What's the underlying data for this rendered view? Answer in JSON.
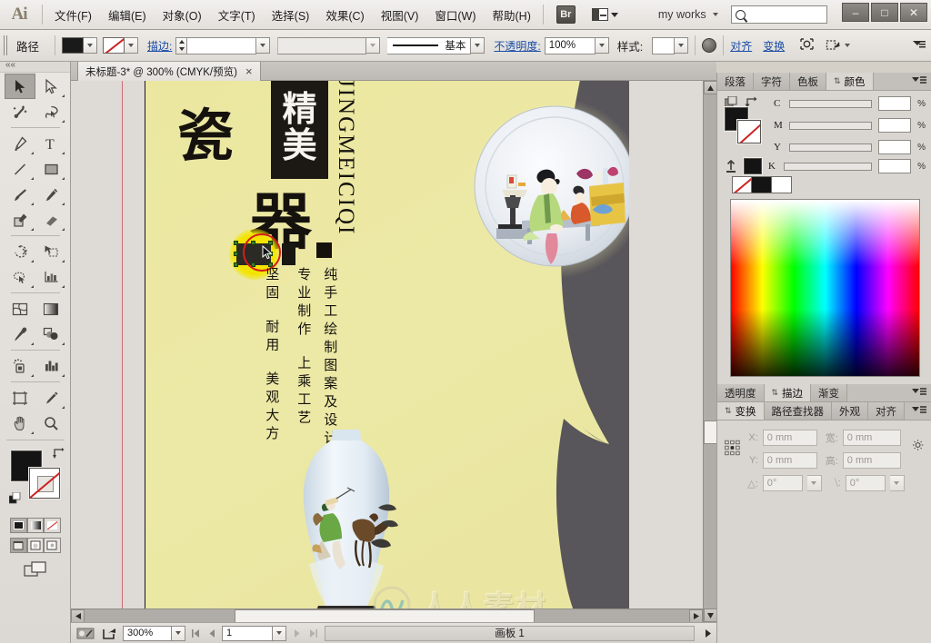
{
  "app": {
    "name": "Ai",
    "logo_text": "Ai"
  },
  "menubar": {
    "items": [
      {
        "label": "文件(F)"
      },
      {
        "label": "编辑(E)"
      },
      {
        "label": "对象(O)"
      },
      {
        "label": "文字(T)"
      },
      {
        "label": "选择(S)"
      },
      {
        "label": "效果(C)"
      },
      {
        "label": "视图(V)"
      },
      {
        "label": "窗口(W)"
      },
      {
        "label": "帮助(H)"
      }
    ],
    "bridge_label": "Br",
    "arrange_icon": "arrange-documents-icon",
    "workspace": "my works",
    "search_placeholder": "",
    "window_controls": {
      "minimize": "–",
      "maximize": "□",
      "close": "✕"
    }
  },
  "controlbar": {
    "object_label": "路径",
    "fill_swatch": "#1a1a1a",
    "stroke_swatch": "none",
    "stroke_label": "描边:",
    "stroke_weight": "",
    "stroke_profile": "",
    "brush_label": "基本",
    "opacity_label": "不透明度:",
    "opacity_value": "100%",
    "style_label": "样式:",
    "recolor_icon": "recolor-artwork-icon",
    "align_label": "对齐",
    "transform_label": "变换",
    "isolate_icon": "isolate-selected-object-icon",
    "draw_mode_icon": "draw-mode-icon",
    "flyout_icon": "panel-menu-icon"
  },
  "doctab": {
    "title": "未标题-3* @ 300% (CMYK/预览)",
    "close": "×"
  },
  "toolbar": {
    "collapse_icon": "collapse-panel-icon",
    "tools": [
      {
        "name": "selection-tool",
        "selected": true
      },
      {
        "name": "direct-selection-tool",
        "selected": false
      },
      {
        "name": "magic-wand-tool",
        "selected": false
      },
      {
        "name": "lasso-tool",
        "selected": false
      },
      {
        "name": "pen-tool",
        "selected": false
      },
      {
        "name": "type-tool",
        "selected": false
      },
      {
        "name": "line-segment-tool",
        "selected": false
      },
      {
        "name": "rectangle-tool",
        "selected": false
      },
      {
        "name": "paintbrush-tool",
        "selected": false
      },
      {
        "name": "pencil-tool",
        "selected": false
      },
      {
        "name": "blob-brush-tool",
        "selected": false
      },
      {
        "name": "eraser-tool",
        "selected": false
      },
      {
        "name": "rotate-tool",
        "selected": false
      },
      {
        "name": "scale-tool",
        "selected": false
      },
      {
        "name": "width-tool",
        "selected": false
      },
      {
        "name": "free-transform-tool",
        "selected": false
      },
      {
        "name": "shape-builder-tool",
        "selected": false
      },
      {
        "name": "perspective-grid-tool",
        "selected": false
      },
      {
        "name": "mesh-tool",
        "selected": false
      },
      {
        "name": "gradient-tool",
        "selected": false
      },
      {
        "name": "eyedropper-tool",
        "selected": false
      },
      {
        "name": "blend-tool",
        "selected": false
      },
      {
        "name": "symbol-sprayer-tool",
        "selected": false
      },
      {
        "name": "column-graph-tool",
        "selected": false
      },
      {
        "name": "artboard-tool",
        "selected": false
      },
      {
        "name": "slice-tool",
        "selected": false
      },
      {
        "name": "hand-tool",
        "selected": false
      },
      {
        "name": "zoom-tool",
        "selected": false
      }
    ],
    "fill_color": "#141414",
    "stroke_color": "none",
    "fill_modes": [
      "color-fill-mode",
      "gradient-fill-mode",
      "none-fill-mode"
    ],
    "screen_modes": [
      "normal-screen-mode",
      "full-screen-menubar-mode",
      "full-screen-mode"
    ]
  },
  "canvas": {
    "artboard_bg": "#ece89f",
    "title_main": "瓷",
    "title_box_line1": "精",
    "title_box_line2": "美",
    "title_sub": "器",
    "pinyin": "JINGMEICIQI",
    "columns": [
      {
        "text": "坚固  耐用  美观大方"
      },
      {
        "text": "专业制作  上乘工艺"
      },
      {
        "text": "纯手工绘制图案及设计"
      }
    ],
    "watermark_text": "人人素材",
    "plate_alt": "porcelain-plate-artwork",
    "vase_alt": "porcelain-vase-artwork"
  },
  "statusbar": {
    "zoom": "300%",
    "page": "1",
    "status_text": "画板 1",
    "cut_icon": "cut-preview-icon",
    "share_icon": "share-on-behance-icon"
  },
  "dock": {
    "top_tabs": [
      {
        "label": "段落",
        "active": false
      },
      {
        "label": "字符",
        "active": false
      },
      {
        "label": "色板",
        "active": false
      },
      {
        "label": "颜色",
        "active": true
      }
    ],
    "color_panel": {
      "channels": [
        {
          "label": "C",
          "value": "",
          "unit": "%"
        },
        {
          "label": "M",
          "value": "",
          "unit": "%"
        },
        {
          "label": "Y",
          "value": "",
          "unit": "%"
        },
        {
          "label": "K",
          "value": "",
          "unit": "%"
        }
      ],
      "fill_color": "#141414",
      "stroke_color": "none",
      "swatch_none": "none",
      "swatch_black": "#141414",
      "swatch_white": "#ffffff"
    },
    "mid_tabs": [
      {
        "label": "透明度",
        "active": false
      },
      {
        "label": "描边",
        "active": true
      },
      {
        "label": "渐变",
        "active": false
      }
    ],
    "bottom_tabs": [
      {
        "label": "变换",
        "active": true
      },
      {
        "label": "路径查找器",
        "active": false
      },
      {
        "label": "外观",
        "active": false
      },
      {
        "label": "对齐",
        "active": false
      }
    ],
    "transform": {
      "x_label": "X:",
      "x_value": "0 mm",
      "y_label": "Y:",
      "y_value": "0 mm",
      "w_label": "宽:",
      "w_value": "0 mm",
      "h_label": "高:",
      "h_value": "0 mm",
      "angle_label": "△:",
      "angle_value": "0°",
      "shear_label": "⧹:",
      "shear_value": "0°",
      "reference_point_icon": "reference-point-selector",
      "constrain_icon": "constrain-proportions-icon"
    }
  }
}
